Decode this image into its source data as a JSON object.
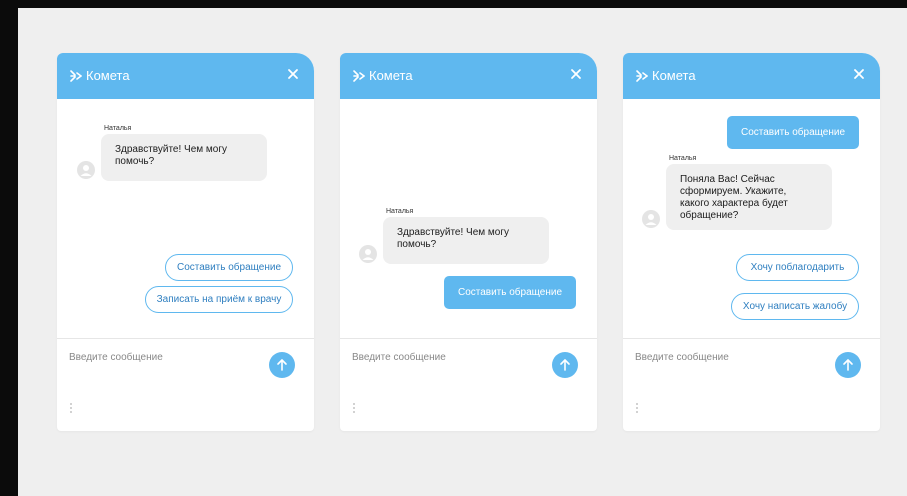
{
  "brand_name": "Комета",
  "input_placeholder": "Введите сообщение",
  "colors": {
    "accent": "#5fb8ef",
    "chip_text": "#2f7fc0",
    "bubble_bg": "#efefef",
    "page_bg": "#efefef"
  },
  "icons": {
    "brand": "kometa-logo-icon",
    "close": "close-icon",
    "avatar": "user-avatar-icon",
    "send": "arrow-up-icon",
    "grip": "drag-handle-icon"
  },
  "widgets": [
    {
      "sender": "Наталья",
      "bubble": "Здравствуйте! Чем могу помочь?",
      "options": [
        "Составить обращение",
        "Записать на приём к врачу"
      ]
    },
    {
      "sender": "Наталья",
      "bubble": "Здравствуйте! Чем могу помочь?",
      "sent": "Составить обращение"
    },
    {
      "sent": "Составить обращение",
      "sender": "Наталья",
      "bubble": "Поняла Вас! Сейчас сформируем. Укажите, какого характера будет обращение?",
      "options": [
        "Хочу поблагодарить",
        "Хочу написать жалобу"
      ]
    }
  ]
}
